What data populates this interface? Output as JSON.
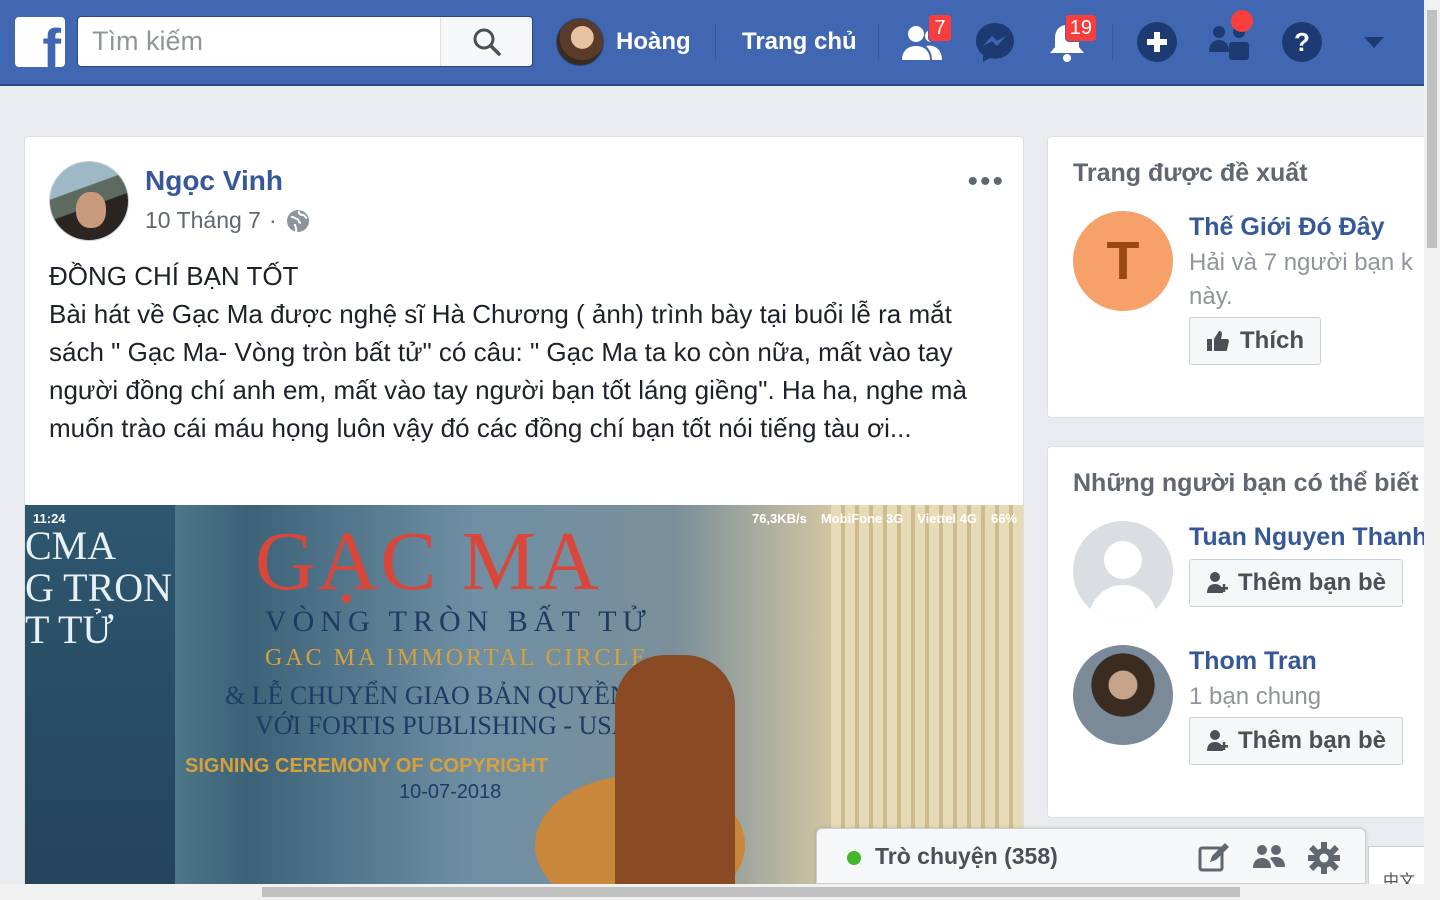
{
  "header": {
    "logo": "f",
    "search_placeholder": "Tìm kiếm",
    "profile_name": "Hoàng",
    "home_label": "Trang chủ",
    "friend_requests_count": "7",
    "notifications_count": "19",
    "icons": [
      "facebook-logo-icon",
      "search-icon",
      "friends-icon",
      "messenger-icon",
      "bell-icon",
      "plus-icon",
      "groups-icon",
      "help-icon",
      "caret-down-icon"
    ],
    "brand_color": "#4267b2"
  },
  "post": {
    "author": "Ngọc Vinh",
    "date": "10 Tháng 7",
    "separator": "·",
    "privacy_icon": "globe-icon",
    "more_icon": "•••",
    "title_line": "ĐỒNG CHÍ BẠN TỐT",
    "body": "Bài hát về Gạc Ma được nghệ sĩ Hà Chương ( ảnh) trình bày tại buổi lễ ra mắt sách \" Gạc Ma- Vòng tròn bất tử\" có câu: \" Gạc Ma ta ko còn nữa, mất vào tay người đồng chí anh em, mất vào tay người bạn tốt láng giềng\". Ha ha, nghe mà muốn trào cái máu họng luôn vậy đó các đồng chí bạn tốt nói tiếng tàu ơi...",
    "image": {
      "status_time": "11:24",
      "status_speed": "76,3KB/s",
      "status_carrier1": "MobiFone 3G",
      "status_carrier2": "Viettel 4G",
      "status_battery": "66%",
      "book_cover": "CMA\nG TRON\nT TỬ",
      "banner_title": "GẠC MA",
      "banner_subtitle": "VÒNG TRÒN BẤT TỬ",
      "banner_subtitle_en": "GAC MA IMMORTAL CIRCLE",
      "banner_line1": "& LỄ CHUYỂN GIAO BẢN QUYỀN",
      "banner_line2": "VỚI FORTIS PUBLISHING - USA",
      "banner_line3": "SIGNING CEREMONY OF COPYRIGHT",
      "banner_date": "10-07-2018"
    }
  },
  "suggested_pages": {
    "title": "Trang được đề xuất",
    "items": [
      {
        "avatar_letter": "T",
        "name": "Thế Giới Đó Đây",
        "context_line1": "Hải và 7 người bạn k",
        "context_line2": "này.",
        "button": "Thích"
      }
    ]
  },
  "people_you_may_know": {
    "title": "Những người bạn có thể biết",
    "items": [
      {
        "name": "Tuan Nguyen Thanh",
        "mutual": "",
        "button": "Thêm bạn bè"
      },
      {
        "name": "Thom Tran",
        "mutual": "1 bạn chung",
        "button": "Thêm bạn bè"
      }
    ]
  },
  "chat": {
    "label": "Trò chuyện (358)",
    "icons": [
      "compose-icon",
      "new-group-icon",
      "settings-icon"
    ]
  },
  "corner_widget": {
    "text": "中文"
  }
}
